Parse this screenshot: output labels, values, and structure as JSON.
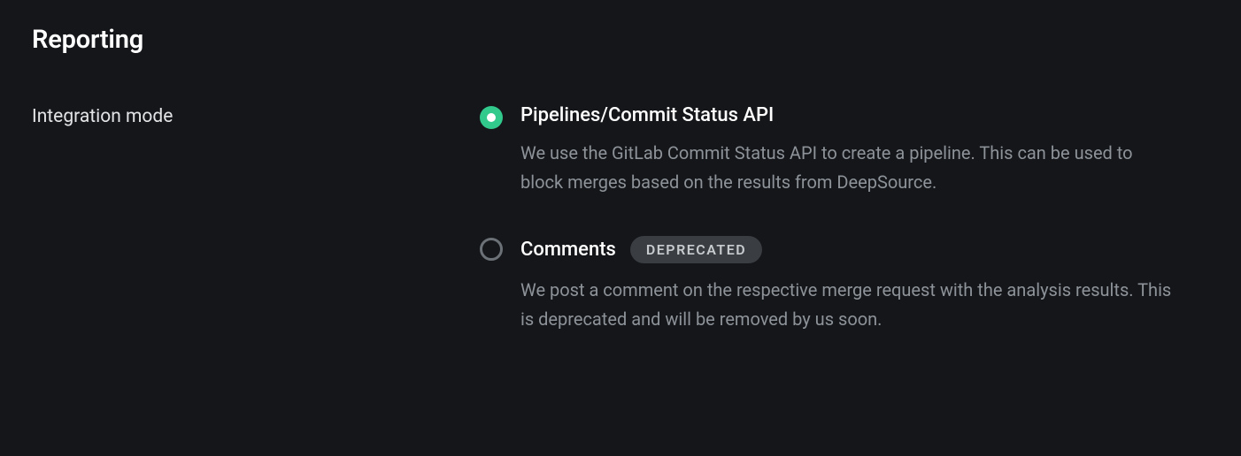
{
  "section": {
    "title": "Reporting"
  },
  "setting": {
    "label": "Integration mode",
    "options": [
      {
        "title": "Pipelines/Commit Status API",
        "description": "We use the GitLab Commit Status API to create a pipeline. This can be used to block merges based on the results from DeepSource.",
        "selected": true,
        "badge": null
      },
      {
        "title": "Comments",
        "description": "We post a comment on the respective merge request with the analysis results. This is deprecated and will be removed by us soon.",
        "selected": false,
        "badge": "DEPRECATED"
      }
    ]
  }
}
